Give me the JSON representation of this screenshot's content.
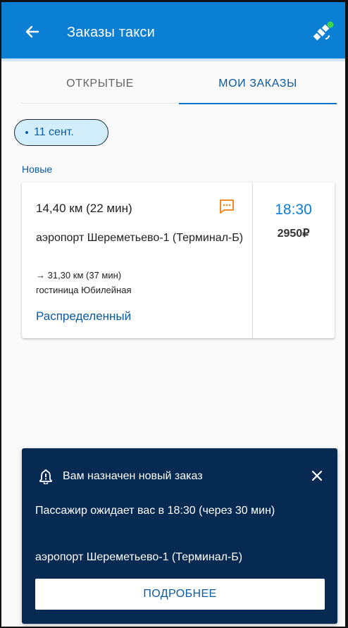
{
  "appbar": {
    "title": "Заказы такси",
    "back_icon": "arrow-left-icon",
    "status_icon": "satellite-icon",
    "color": "#0b7fd4"
  },
  "tabs": [
    {
      "label": "ОТКРЫТЫЕ",
      "active": false
    },
    {
      "label": "МОИ ЗАКАЗЫ",
      "active": true
    }
  ],
  "date_chip": {
    "label": "11 сент."
  },
  "section": {
    "label": "Новые"
  },
  "order": {
    "distance": "14,40 км (22 мин)",
    "from": "аэропорт Шереметьево-1 (Терминал-Б)",
    "to_distance": "→ 31,30 км (37 мин)",
    "to": "гостиница Юбилейная",
    "status": "Распределенный",
    "time": "18:30",
    "price": "2950₽",
    "chat_icon": "chat-icon",
    "chat_color": "#f08a24"
  },
  "notification": {
    "icon": "bell-icon",
    "title": "Вам назначен новый заказ",
    "message": "Пассажир ожидает вас в 18:30 (через 30 мин)",
    "address": "аэропорт Шереметьево-1 (Терминал-Б)",
    "button": "ПОДРОБНЕЕ",
    "color": "#062a52"
  }
}
